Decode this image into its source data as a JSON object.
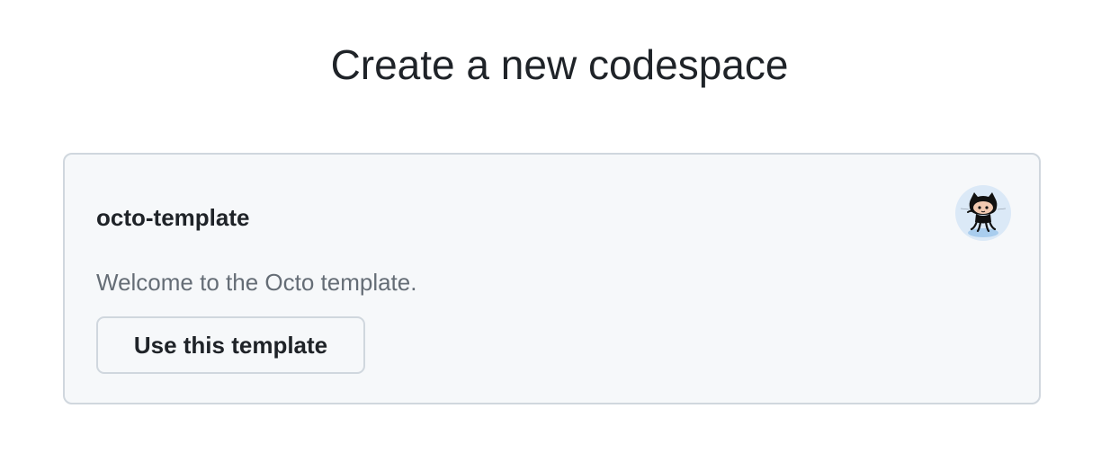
{
  "header": {
    "title": "Create a new codespace"
  },
  "template_card": {
    "name": "octo-template",
    "description": "Welcome to the Octo template.",
    "button_label": "Use this template",
    "avatar_icon": "octocat-icon"
  },
  "colors": {
    "card_background": "#f6f8fa",
    "card_border": "#d0d7de",
    "text_primary": "#1f2328",
    "text_muted": "#656d76",
    "avatar_background": "#dbe9f7"
  }
}
